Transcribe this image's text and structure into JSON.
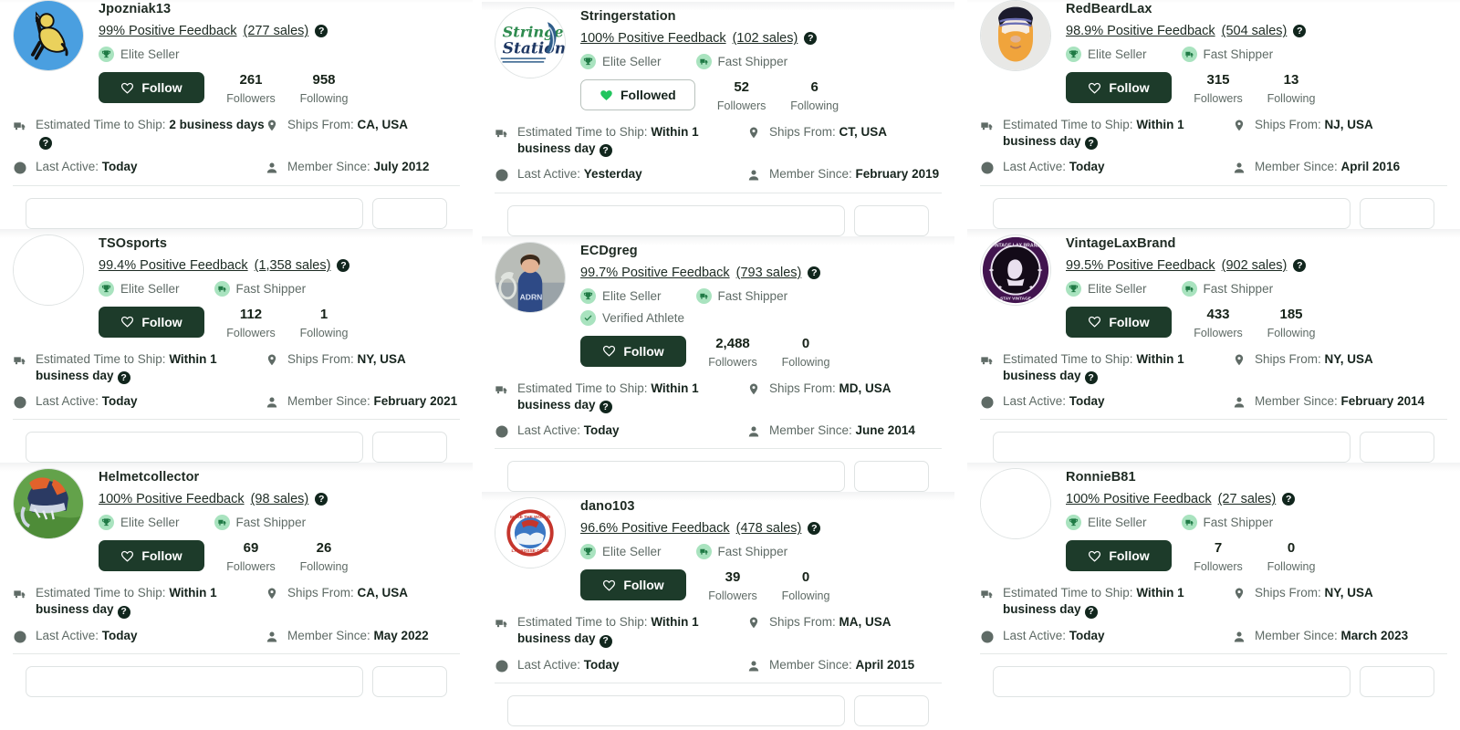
{
  "labels": {
    "elite_seller": "Elite Seller",
    "fast_shipper": "Fast Shipper",
    "verified_athlete": "Verified Athlete",
    "follow": "Follow",
    "followed": "Followed",
    "followers": "Followers",
    "following": "Following",
    "est_ship_prefix": "Estimated Time to Ship: ",
    "ships_from_prefix": "Ships From: ",
    "last_active_prefix": "Last Active: ",
    "member_since_prefix": "Member Since: ",
    "help_glyph": "?"
  },
  "colors": {
    "brand_dark_green": "#1d3b2a",
    "badge_mint": "#a9e3bf",
    "badge_icon_green": "#1f7a45",
    "heart_green": "#22c55e",
    "text_muted": "#5f6b66",
    "text_dark": "#16241d",
    "divider": "#e4e8e7"
  },
  "columns": [
    {
      "cards": [
        {
          "username": "Jpozniak13",
          "feedback": "99% Positive Feedback",
          "sales": "(277 sales)",
          "badges": [
            "elite_seller"
          ],
          "follow_state": "follow",
          "followers": "261",
          "following": "958",
          "est_ship": "2 business days",
          "ships_from": "CA, USA",
          "last_active": "Today",
          "member_since": "July 2012",
          "avatar": "aim-running-man"
        },
        {
          "username": "TSOsports",
          "feedback": "99.4% Positive Feedback",
          "sales": "(1,358 sales)",
          "badges": [
            "elite_seller",
            "fast_shipper"
          ],
          "follow_state": "follow",
          "followers": "112",
          "following": "1",
          "est_ship": "Within 1 business day",
          "ships_from": "NY, USA",
          "last_active": "Today",
          "member_since": "February 2021",
          "avatar": "blank"
        },
        {
          "username": "Helmetcollector",
          "feedback": "100% Positive Feedback",
          "sales": "(98 sales)",
          "badges": [
            "elite_seller",
            "fast_shipper"
          ],
          "follow_state": "follow",
          "followers": "69",
          "following": "26",
          "est_ship": "Within 1 business day",
          "ships_from": "CA, USA",
          "last_active": "Today",
          "member_since": "May 2022",
          "avatar": "lacrosse-helmet"
        }
      ]
    },
    {
      "cards": [
        {
          "username": "Stringerstation",
          "feedback": "100% Positive Feedback",
          "sales": "(102 sales)",
          "badges": [
            "elite_seller",
            "fast_shipper"
          ],
          "follow_state": "followed",
          "followers": "52",
          "following": "6",
          "est_ship": "Within 1 business day",
          "ships_from": "CT, USA",
          "last_active": "Yesterday",
          "member_since": "February 2019",
          "avatar": "stringers-station-logo"
        },
        {
          "username": "ECDgreg",
          "feedback": "99.7% Positive Feedback",
          "sales": "(793 sales)",
          "badges": [
            "elite_seller",
            "fast_shipper",
            "verified_athlete"
          ],
          "follow_state": "follow",
          "followers": "2,488",
          "following": "0",
          "est_ship": "Within 1 business day",
          "ships_from": "MD, USA",
          "last_active": "Today",
          "member_since": "June 2014",
          "avatar": "player-photo"
        },
        {
          "username": "dano103",
          "feedback": "96.6% Positive Feedback",
          "sales": "(478 sales)",
          "badges": [
            "elite_seller",
            "fast_shipper"
          ],
          "follow_state": "follow",
          "followers": "39",
          "following": "0",
          "est_ship": "Within 1 business day",
          "ships_from": "MA, USA",
          "last_active": "Today",
          "member_since": "April 2015",
          "avatar": "circle-club-logo"
        }
      ]
    },
    {
      "cards": [
        {
          "username": "RedBeardLax",
          "feedback": "98.9% Positive Feedback",
          "sales": "(504 sales)",
          "badges": [
            "elite_seller",
            "fast_shipper"
          ],
          "follow_state": "follow",
          "followers": "315",
          "following": "13",
          "est_ship": "Within 1 business day",
          "ships_from": "NJ, USA",
          "last_active": "Today",
          "member_since": "April 2016",
          "avatar": "bearded-face"
        },
        {
          "username": "VintageLaxBrand",
          "feedback": "99.5% Positive Feedback",
          "sales": "(902 sales)",
          "badges": [
            "elite_seller",
            "fast_shipper"
          ],
          "follow_state": "follow",
          "followers": "433",
          "following": "185",
          "est_ship": "Within 1 business day",
          "ships_from": "NY, USA",
          "last_active": "Today",
          "member_since": "February 2014",
          "avatar": "vintage-lax-seal"
        },
        {
          "username": "RonnieB81",
          "feedback": "100% Positive Feedback",
          "sales": "(27 sales)",
          "badges": [
            "elite_seller",
            "fast_shipper"
          ],
          "follow_state": "follow",
          "followers": "7",
          "following": "0",
          "est_ship": "Within 1 business day",
          "ships_from": "NY, USA",
          "last_active": "Today",
          "member_since": "March 2023",
          "avatar": "blank"
        }
      ]
    }
  ]
}
